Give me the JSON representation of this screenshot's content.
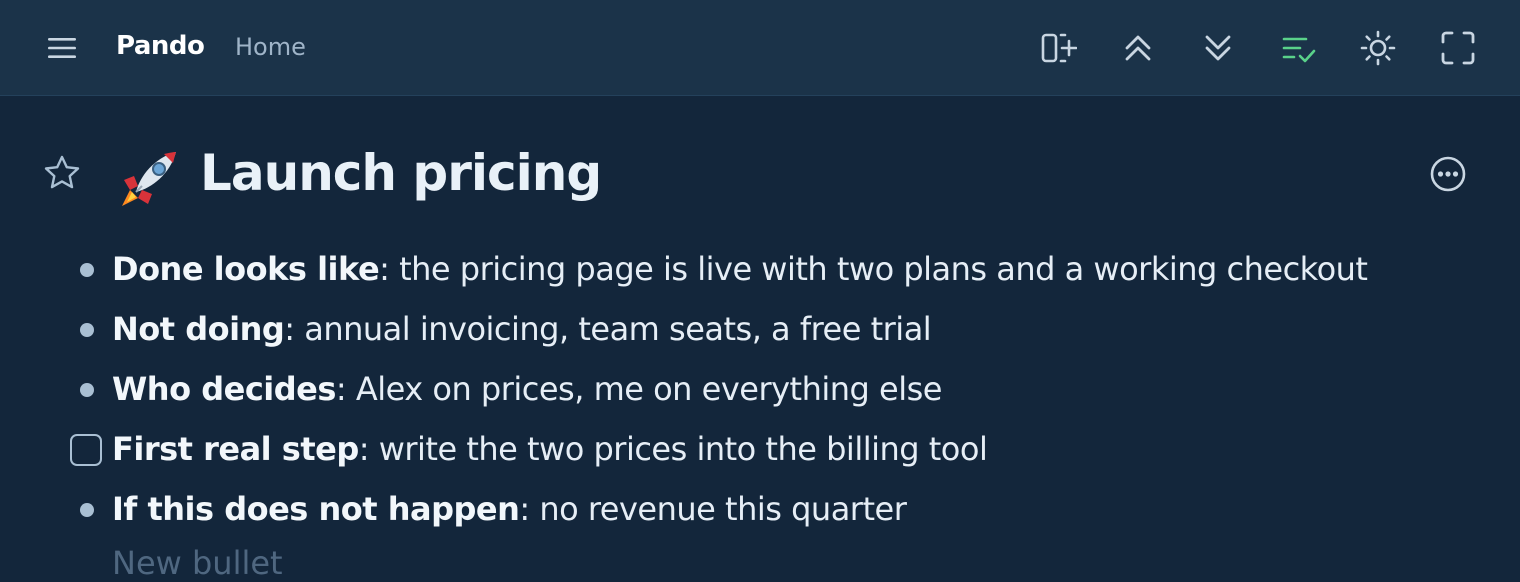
{
  "header": {
    "brand": "Pando",
    "breadcrumb": "Home",
    "icons": [
      "add-panel-icon",
      "collapse-all-icon",
      "expand-all-icon",
      "checklist-icon",
      "theme-toggle-icon",
      "fullscreen-icon"
    ],
    "accent_color": "#5ad28a"
  },
  "page": {
    "emoji": "🚀",
    "title": "Launch pricing",
    "items": [
      {
        "kind": "bullet",
        "label": "Done looks like",
        "text": ": the pricing page is live with two plans and a working checkout"
      },
      {
        "kind": "bullet",
        "label": "Not doing",
        "text": ": annual invoicing, team seats, a free trial"
      },
      {
        "kind": "bullet",
        "label": "Who decides",
        "text": ": Alex on prices, me on everything else"
      },
      {
        "kind": "checkbox",
        "checked": false,
        "label": "First real step",
        "text": ": write the two prices into the billing tool"
      },
      {
        "kind": "bullet",
        "label": "If this does not happen",
        "text": ": no revenue this quarter"
      }
    ],
    "next_placeholder": "New bullet"
  }
}
